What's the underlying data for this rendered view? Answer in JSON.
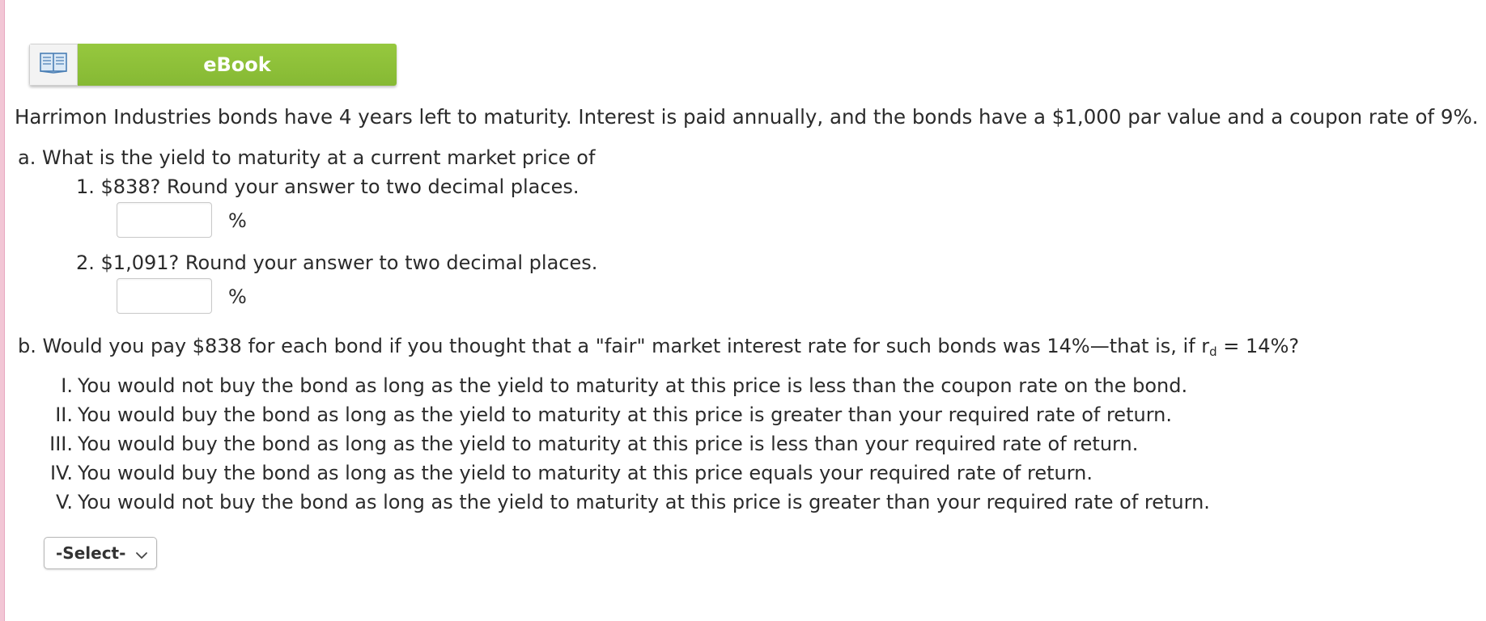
{
  "ebook": {
    "label": "eBook",
    "icon": "open-book-icon",
    "accent_color": "#8bbd37"
  },
  "problem": {
    "intro": "Harrimon Industries bonds have 4 years left to maturity. Interest is paid annually, and the bonds have a $1,000 par value and a coupon rate of 9%.",
    "part_a": {
      "prompt": "a. What is the yield to maturity at a current market price of",
      "items": [
        {
          "label": "1. $838? Round your answer to two decimal places.",
          "value": "",
          "unit": "%"
        },
        {
          "label": "2. $1,091? Round your answer to two decimal places.",
          "value": "",
          "unit": "%"
        }
      ]
    },
    "part_b": {
      "prompt_pre": "b. Would you pay $838 for each bond if you thought that a \"fair\" market interest rate for such bonds was 14%—that is, if r",
      "prompt_sub": "d",
      "prompt_post": " = 14%?",
      "options": [
        {
          "num": "I.",
          "text": "You would not buy the bond as long as the yield to maturity at this price is less than the coupon rate on the bond."
        },
        {
          "num": "II.",
          "text": "You would buy the bond as long as the yield to maturity at this price is greater than your required rate of return."
        },
        {
          "num": "III.",
          "text": "You would buy the bond as long as the yield to maturity at this price is less than your required rate of return."
        },
        {
          "num": "IV.",
          "text": "You would buy the bond as long as the yield to maturity at this price equals your required rate of return."
        },
        {
          "num": "V.",
          "text": "You would not buy the bond as long as the yield to maturity at this price is greater than your required rate of return."
        }
      ],
      "select": {
        "selected": "-Select-",
        "icon": "chevron-down-icon"
      }
    }
  }
}
